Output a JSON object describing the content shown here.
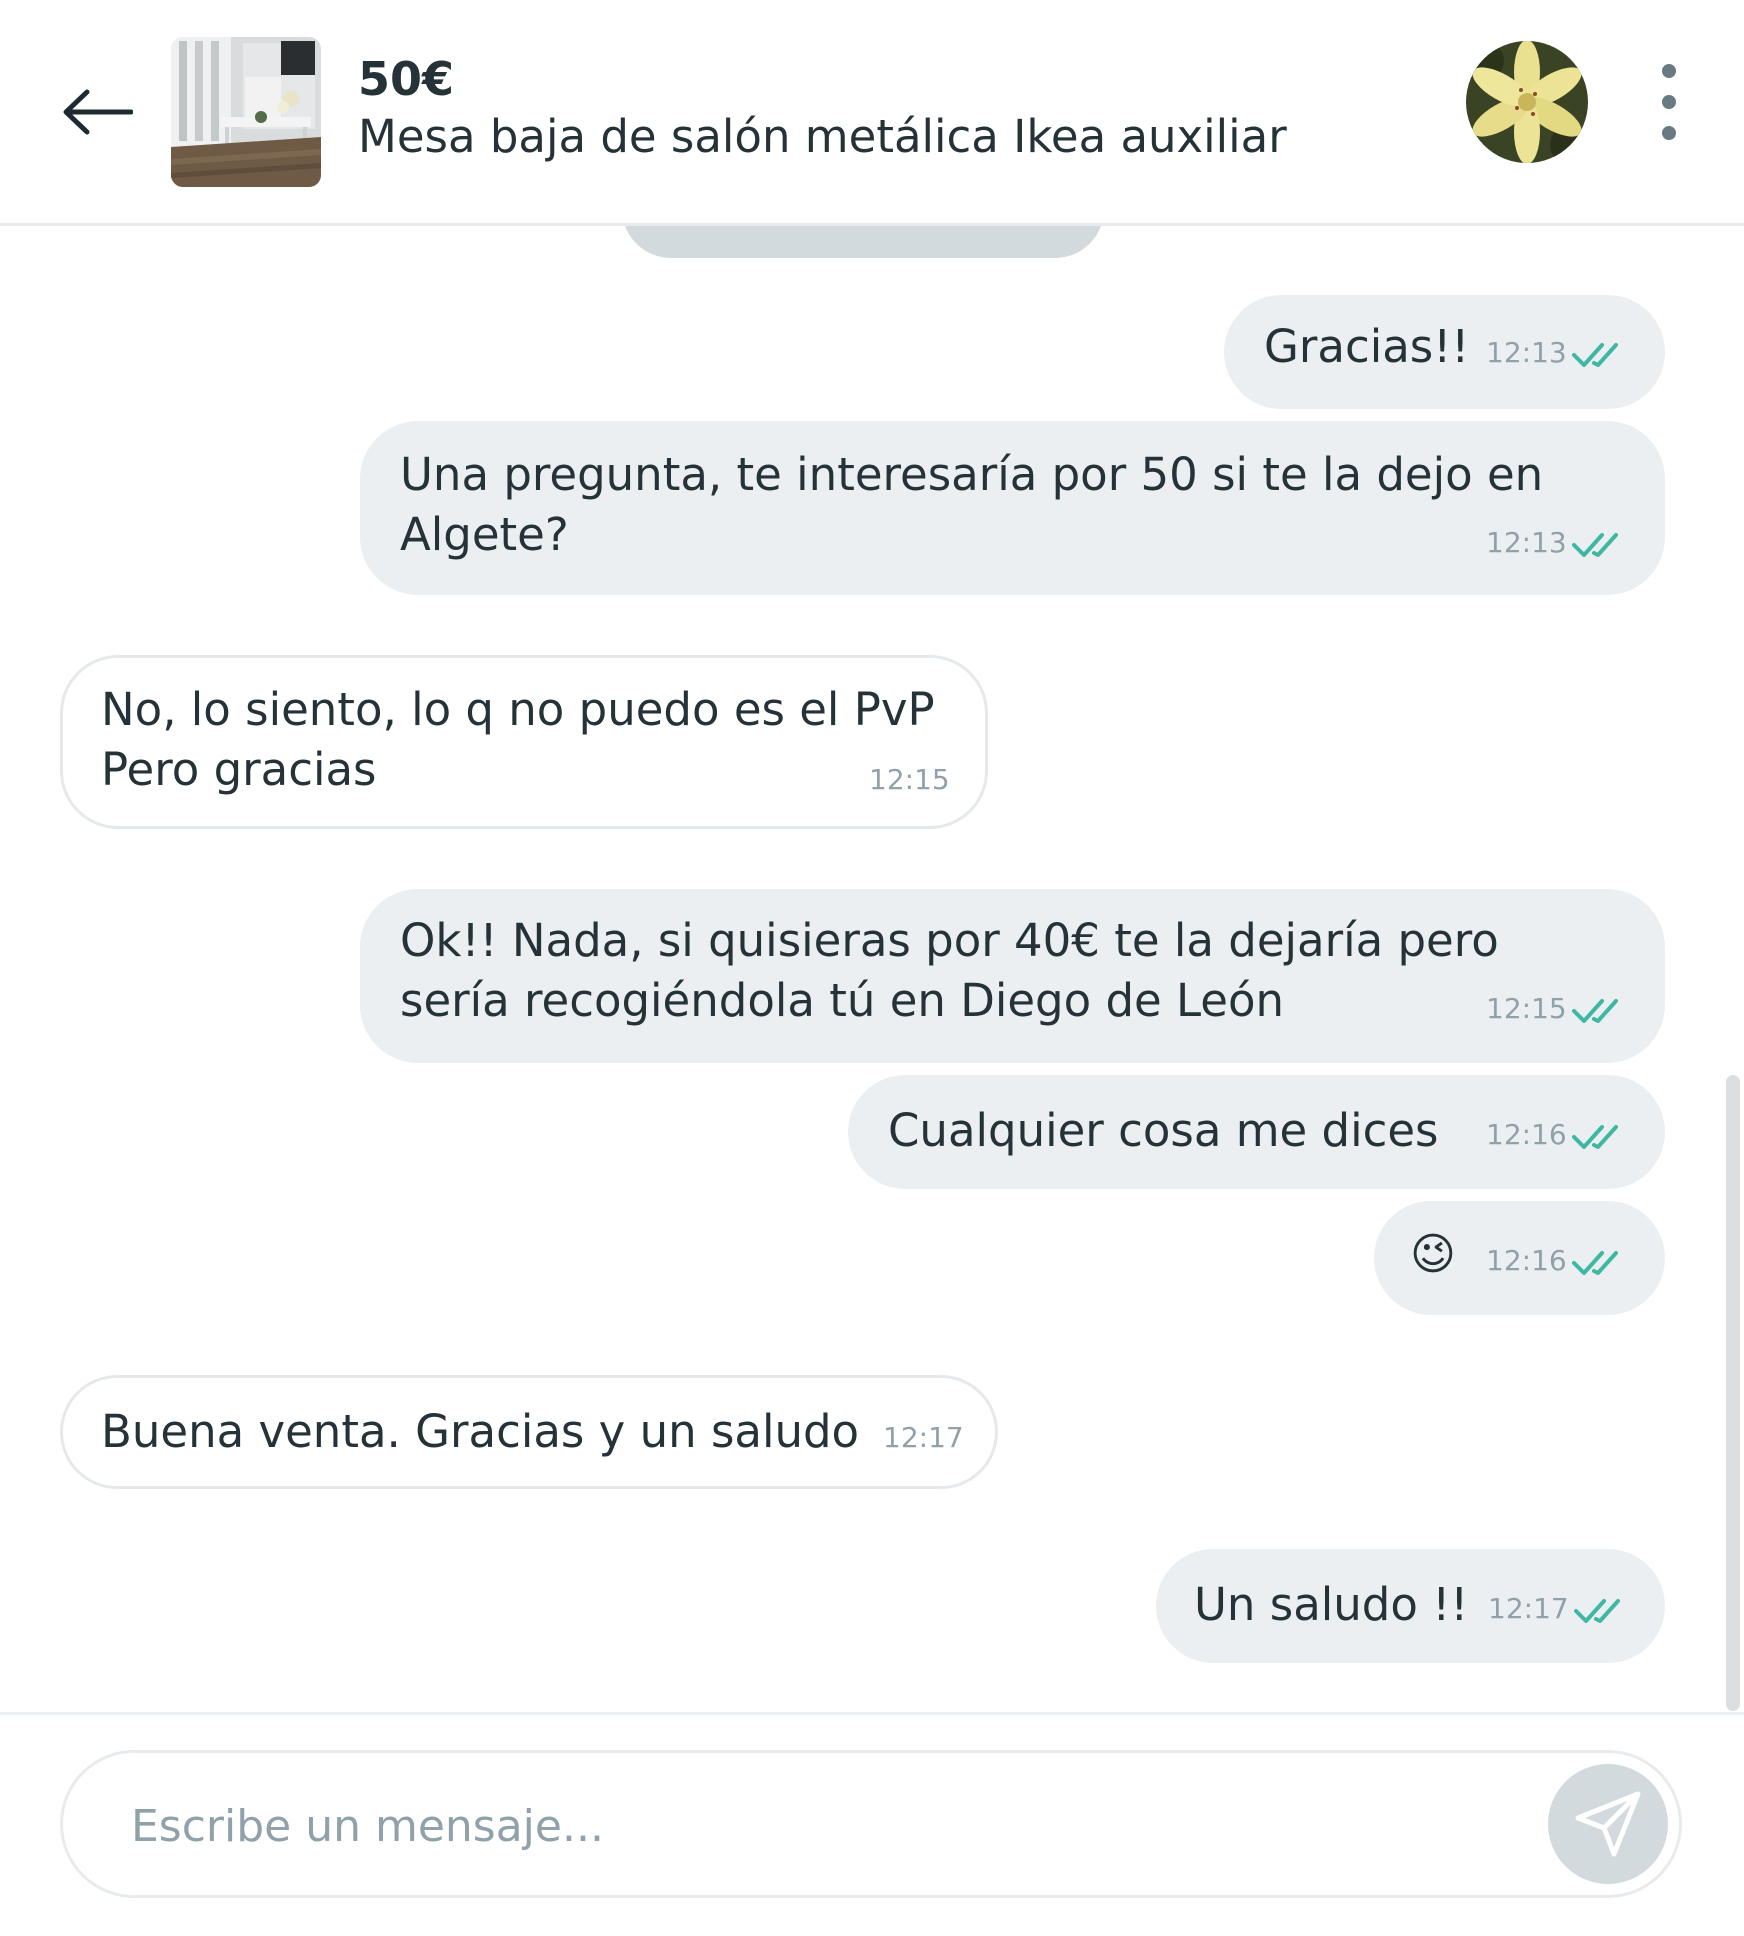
{
  "header": {
    "back_icon": "arrow-left-icon",
    "price": "50€",
    "title": "Mesa baja de salón metálica Ikea auxiliar",
    "more_icon": "more-vertical-icon"
  },
  "messages": [
    {
      "dir": "out",
      "text": "Gracias!!",
      "time": "12:13",
      "status": "read"
    },
    {
      "dir": "out",
      "lines": [
        "Una pregunta, te interesaría por 50 si te la dejo en",
        "Algete?"
      ],
      "time": "12:13",
      "status": "read"
    },
    {
      "dir": "in",
      "lines": [
        "No, lo siento, lo q no puedo es el PvP",
        "Pero gracias"
      ],
      "time": "12:15"
    },
    {
      "dir": "out",
      "lines": [
        "Ok!! Nada, si quisieras por 40€ te la dejaría pero",
        "sería recogiéndola tú en Diego de León"
      ],
      "time": "12:15",
      "status": "read"
    },
    {
      "dir": "out",
      "text": "Cualquier cosa me dices",
      "time": "12:16",
      "status": "read"
    },
    {
      "dir": "out",
      "text": "😉",
      "time": "12:16",
      "status": "read"
    },
    {
      "dir": "in",
      "text": "Buena venta. Gracias y un saludo",
      "time": "12:17"
    },
    {
      "dir": "out",
      "text": "Un saludo !!",
      "time": "12:17",
      "status": "read"
    }
  ],
  "composer": {
    "placeholder": "Escribe un mensaje...",
    "value": "",
    "send_icon": "send-icon"
  },
  "colors": {
    "read_check": "#3fb8a3",
    "outgoing_bubble": "#eceff1",
    "incoming_border": "#e6e9eb",
    "text": "#253238",
    "time": "#90a1aa"
  }
}
